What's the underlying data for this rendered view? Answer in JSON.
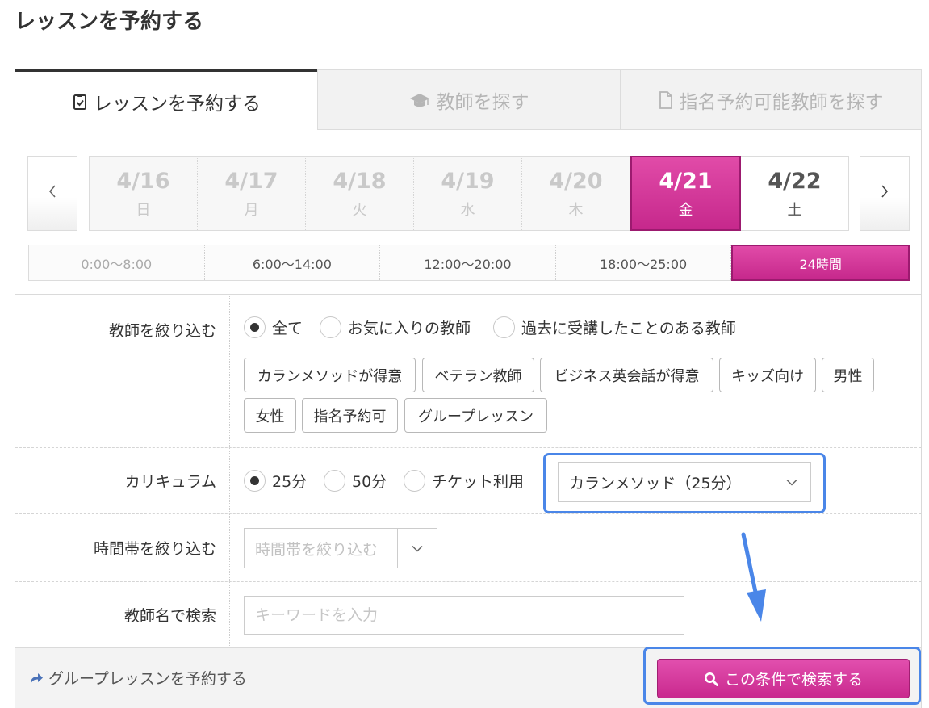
{
  "page": {
    "title": "レッスンを予約する"
  },
  "tabs": [
    {
      "label": "レッスンを予約する",
      "icon": "clipboard-check-icon",
      "active": true
    },
    {
      "label": "教師を探す",
      "icon": "graduation-cap-icon",
      "active": false
    },
    {
      "label": "指名予約可能教師を探す",
      "icon": "document-icon",
      "active": false
    }
  ],
  "date_nav": {
    "prev_icon": "chevron-left-icon",
    "next_icon": "chevron-right-icon",
    "dates": [
      {
        "date": "4/16",
        "weekday": "日",
        "state": "disabled"
      },
      {
        "date": "4/17",
        "weekday": "月",
        "state": "disabled"
      },
      {
        "date": "4/18",
        "weekday": "火",
        "state": "disabled"
      },
      {
        "date": "4/19",
        "weekday": "水",
        "state": "disabled"
      },
      {
        "date": "4/20",
        "weekday": "木",
        "state": "disabled"
      },
      {
        "date": "4/21",
        "weekday": "金",
        "state": "selected"
      },
      {
        "date": "4/22",
        "weekday": "土",
        "state": "available"
      }
    ]
  },
  "time_ranges": [
    {
      "label": "0:00〜8:00",
      "selected": false
    },
    {
      "label": "6:00〜14:00",
      "selected": false
    },
    {
      "label": "12:00〜20:00",
      "selected": false
    },
    {
      "label": "18:00〜25:00",
      "selected": false
    },
    {
      "label": "24時間",
      "selected": true
    }
  ],
  "filters": {
    "teacher_filter": {
      "label": "教師を絞り込む",
      "radios": [
        {
          "label": "全て",
          "checked": true
        },
        {
          "label": "お気に入りの教師",
          "checked": false
        },
        {
          "label": "過去に受講したことのある教師",
          "checked": false
        }
      ],
      "chips": [
        "カランメソッドが得意",
        "ベテラン教師",
        "ビジネス英会話が得意",
        "キッズ向け",
        "男性",
        "女性",
        "指名予約可",
        "グループレッスン"
      ]
    },
    "curriculum": {
      "label": "カリキュラム",
      "radios": [
        {
          "label": "25分",
          "checked": true
        },
        {
          "label": "50分",
          "checked": false
        },
        {
          "label": "チケット利用",
          "checked": false
        }
      ],
      "select_value": "カランメソッド（25分）"
    },
    "time_of_day": {
      "label": "時間帯を絞り込む",
      "placeholder": "時間帯を絞り込む"
    },
    "teacher_name": {
      "label": "教師名で検索",
      "placeholder": "キーワードを入力"
    }
  },
  "footer": {
    "group_link": "グループレッスンを予約する",
    "search_button": "この条件で検索する"
  },
  "colors": {
    "accent": "#d4389a",
    "annotation": "#4a86e8"
  }
}
